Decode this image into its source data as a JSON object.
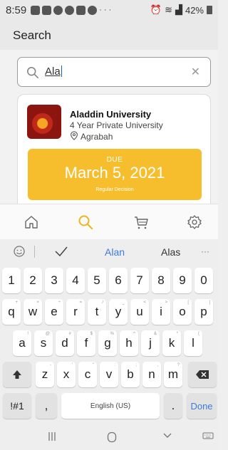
{
  "status_bar": {
    "time": "8:59",
    "battery": "42%"
  },
  "header": {
    "title": "Search"
  },
  "search": {
    "query": "Ala"
  },
  "result": {
    "name": "Aladdin University",
    "type": "4 Year Private University",
    "location": "Agrabah",
    "deadline_label": "DUE",
    "deadline_date": "March 5, 2021",
    "deadline_type": "Regular Decision",
    "deadline_color": "#f6be2c"
  },
  "bottom_nav": [
    "home-icon",
    "search-icon",
    "cart-icon",
    "settings-icon"
  ],
  "keyboard": {
    "suggestions": [
      "Alan",
      "Alas"
    ],
    "rows": {
      "numbers": [
        "1",
        "2",
        "3",
        "4",
        "5",
        "6",
        "7",
        "8",
        "9",
        "0"
      ],
      "row1": [
        "q",
        "w",
        "e",
        "r",
        "t",
        "y",
        "u",
        "i",
        "o",
        "p"
      ],
      "row1_hints": [
        "+",
        "×",
        "÷",
        "=",
        "/",
        "_",
        "<",
        ">",
        "[",
        "]"
      ],
      "row2": [
        "a",
        "s",
        "d",
        "f",
        "g",
        "h",
        "j",
        "k",
        "l"
      ],
      "row2_hints": [
        "!",
        "@",
        "#",
        "$",
        "%",
        "^",
        "&",
        "*",
        "("
      ],
      "row3": [
        "z",
        "x",
        "c",
        "v",
        "b",
        "n",
        "m"
      ],
      "row3_hints": [
        "-",
        "'",
        "\"",
        ":",
        ";",
        ",",
        "?"
      ]
    },
    "symbols_key": "!#1",
    "comma_key": ",",
    "space_label": "English (US)",
    "period_key": ".",
    "done_label": "Done"
  }
}
